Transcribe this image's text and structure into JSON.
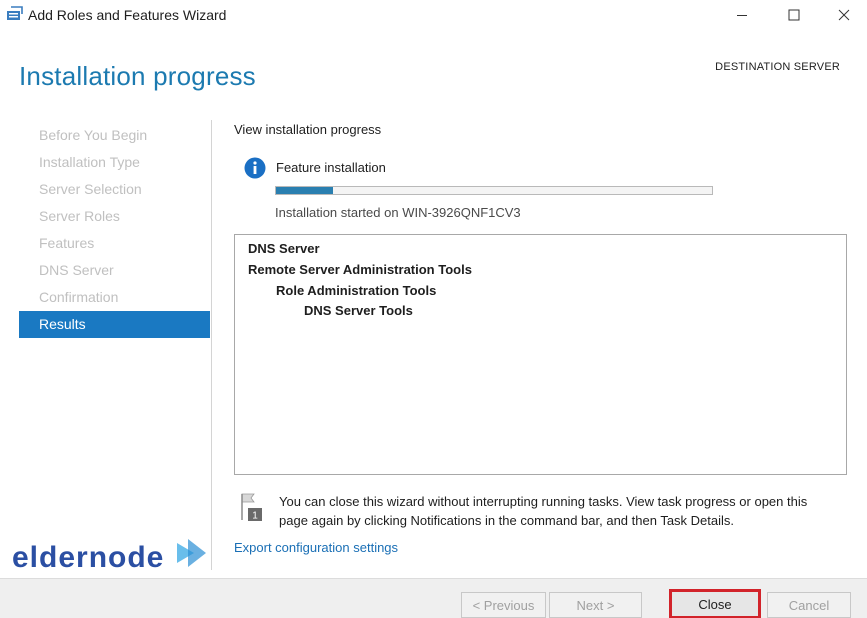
{
  "window": {
    "title": "Add Roles and Features Wizard",
    "min_icon": "minimize-icon",
    "max_icon": "maximize-icon",
    "close_icon": "close-icon"
  },
  "header": {
    "title": "Installation progress",
    "destination_label": "DESTINATION SERVER"
  },
  "nav": {
    "items": [
      {
        "label": "Before You Begin",
        "active": false
      },
      {
        "label": "Installation Type",
        "active": false
      },
      {
        "label": "Server Selection",
        "active": false
      },
      {
        "label": "Server Roles",
        "active": false
      },
      {
        "label": "Features",
        "active": false
      },
      {
        "label": "DNS Server",
        "active": false
      },
      {
        "label": "Confirmation",
        "active": false
      },
      {
        "label": "Results",
        "active": true
      }
    ]
  },
  "main": {
    "section_heading": "View installation progress",
    "feature_label": "Feature installation",
    "progress_fraction": 0.13,
    "started_text": "Installation started on WIN-3926QNF1CV3",
    "results": [
      {
        "label": "DNS Server",
        "level": 0
      },
      {
        "label": "Remote Server Administration Tools",
        "level": 0
      },
      {
        "label": "Role Administration Tools",
        "level": 1
      },
      {
        "label": "DNS Server Tools",
        "level": 2
      }
    ],
    "notice_badge": "1",
    "notice_text": "You can close this wizard without interrupting running tasks. View task progress or open this page again by clicking Notifications in the command bar, and then Task Details.",
    "export_link": "Export configuration settings"
  },
  "watermark": {
    "text": "eldernode"
  },
  "footer": {
    "previous_label": "< Previous",
    "next_label": "Next >",
    "close_label": "Close",
    "cancel_label": "Cancel"
  },
  "colors": {
    "accent": "#1c7ab0",
    "nav_active": "#1a79c2",
    "progress": "#2a7fb0",
    "link": "#1a6fb5",
    "highlight_border": "#d2232a"
  }
}
